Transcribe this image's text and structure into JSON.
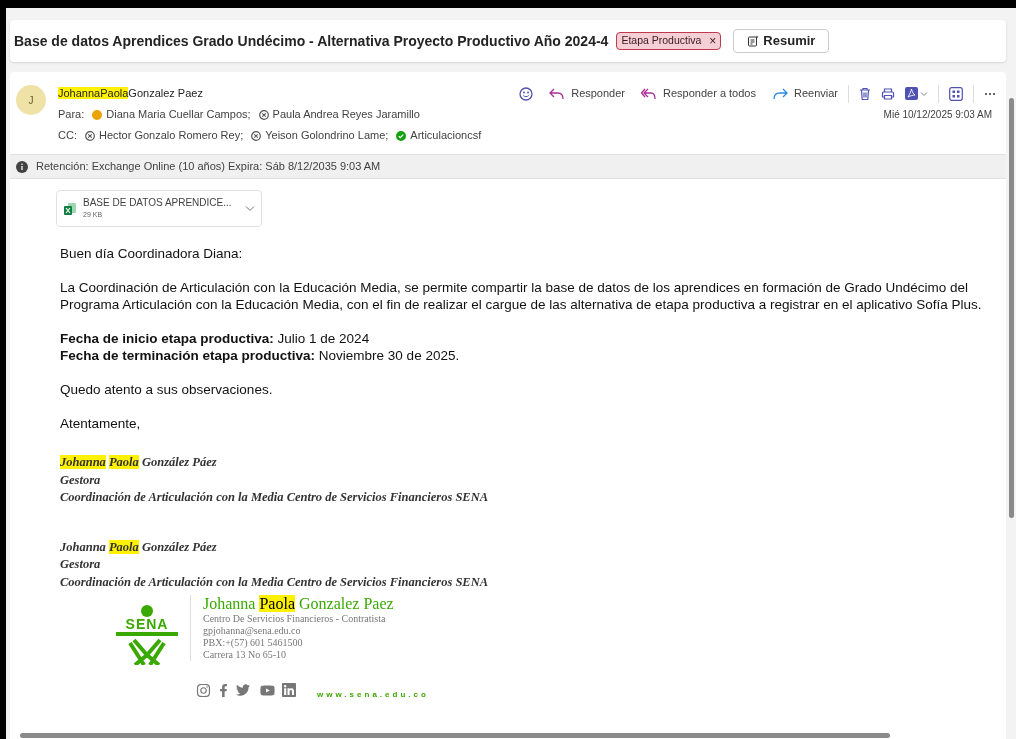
{
  "subject": {
    "title": "Base de datos Aprendices Grado Undécimo - Alternativa Proyecto Productivo Año 2024-4",
    "tag": "Etapa Productiva",
    "tag_close": "×",
    "summarize": "Resumir"
  },
  "message": {
    "avatar": "J",
    "sender": [
      {
        "text": "JohannaPaola",
        "highlighted": true
      },
      {
        "text": "Gonzalez Paez",
        "highlighted": false
      }
    ],
    "to_label": "Para:",
    "to": [
      {
        "name": "Diana Maria Cuellar Campos;",
        "kind": "away"
      },
      {
        "name": "Paula Andrea Reyes Jaramillo",
        "kind": "unknown"
      }
    ],
    "cc_label": "CC:",
    "cc": [
      {
        "name": "Hector Gonzalo Romero Rey;",
        "kind": "unknown"
      },
      {
        "name": "Yeison Golondrino Lame;",
        "kind": "unknown"
      },
      {
        "name": "Articulacioncsf",
        "kind": "available"
      }
    ],
    "actions": [
      "Responder",
      "Responder a todos",
      "Reenviar"
    ],
    "date": "Mié 10/12/2025 9:03 AM"
  },
  "retention": "Retención: Exchange Online (10 años) Expira: Sáb 8/12/2035 9:03 AM",
  "attachment": {
    "name": "BASE DE DATOS APRENDICE...",
    "size": "29 KB"
  },
  "body": [
    "Buen día Coordinadora Diana:",
    "La Coordinación de Articulación con la Educación Media, se permite compartir la base de datos de los aprendices en formación de Grado Undécimo del Programa Articulación con la Educación Media, con el fin de  realizar el cargue de las alternativa  de etapa productiva a registrar en el aplicativo Sofía Plus.",
    "**Fecha de inicio etapa productiva:** Julio 1 de 2024\n**Fecha de terminación etapa productiva:** Noviembre 30 de 2025.",
    "Quedo atento a sus observaciones.",
    "Atentamente,"
  ],
  "signatures": [
    {
      "name": [
        {
          "text": "Johanna",
          "highlighted": true
        },
        {
          "text": "Paola",
          "highlighted": true
        },
        {
          "text": "González Páez",
          "highlighted": false
        }
      ],
      "role": "Gestora",
      "org": "Coordinación de Articulación con la Media Centro de Servicios Financieros SENA"
    },
    {
      "name": [
        {
          "text": "Johanna",
          "highlighted": false
        },
        {
          "text": "Paola",
          "highlighted": true
        },
        {
          "text": "González Páez",
          "highlighted": false
        }
      ],
      "role": "Gestora",
      "org": "Coordinación de Articulación con la Media Centro de Servicios Financieros SENA"
    }
  ],
  "card": {
    "logo": "SENA",
    "name": [
      {
        "text": "Johanna ",
        "highlighted": false
      },
      {
        "text": "Paola",
        "highlighted": true
      },
      {
        "text": " Gonzalez Paez",
        "highlighted": false
      }
    ],
    "lines": [
      "Centro De Servicios Financieros - Contratista",
      "gpjohanna@sena.edu.co",
      "PBX:+(57) 601 5461500",
      "Carrera 13 No 65-10"
    ],
    "website": "www.sena.edu.co"
  }
}
